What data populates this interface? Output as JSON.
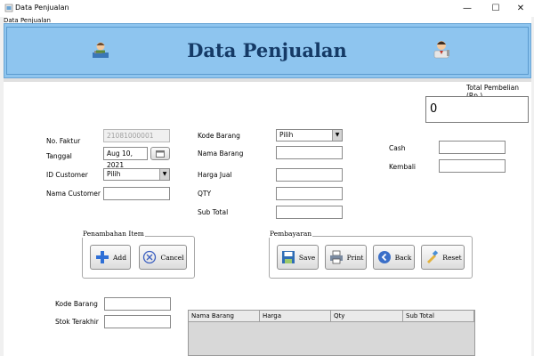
{
  "window": {
    "title": "Data Penjualan",
    "frame_label": "Data Penjualan",
    "minimize": "—",
    "maximize": "☐",
    "close": "✕"
  },
  "header": {
    "title": "Data Penjualan"
  },
  "total": {
    "label": "Total Pembelian (Rp.)",
    "value": "0"
  },
  "form": {
    "no_faktur_label": "No. Faktur",
    "no_faktur_value": "21081000001",
    "tanggal_label": "Tanggal",
    "tanggal_value": "Aug 10, 2021",
    "id_customer_label": "ID Customer",
    "id_customer_value": "Pilih",
    "nama_customer_label": "Nama Customer",
    "nama_customer_value": "",
    "kode_barang_label": "Kode Barang",
    "kode_barang_value": "Pilih",
    "nama_barang_label": "Nama Barang",
    "nama_barang_value": "",
    "harga_jual_label": "Harga Jual",
    "harga_jual_value": "",
    "qty_label": "QTY",
    "qty_value": "",
    "sub_total_label": "Sub Total",
    "sub_total_value": "",
    "cash_label": "Cash",
    "cash_value": "",
    "kembali_label": "Kembali",
    "kembali_value": ""
  },
  "penambahan": {
    "title": "Penambahan Item",
    "add_label": "Add",
    "cancel_label": "Cancel"
  },
  "pembayaran": {
    "title": "Pembayaran",
    "save_label": "Save",
    "print_label": "Print",
    "back_label": "Back",
    "reset_label": "Reset"
  },
  "stock": {
    "kode_barang_label": "Kode Barang",
    "kode_barang_value": "",
    "stok_label": "Stok Terakhir",
    "stok_value": ""
  },
  "table": {
    "columns": [
      "Nama Barang",
      "Harga",
      "Qty",
      "Sub Total"
    ]
  },
  "colors": {
    "banner": "#8ec5ef",
    "banner_title": "#153a66"
  },
  "icons": [
    "window-app-icon",
    "cashier-left-icon",
    "cashier-right-icon",
    "calendar-icon",
    "add-icon",
    "cancel-icon",
    "save-icon",
    "print-icon",
    "back-icon",
    "reset-icon"
  ]
}
